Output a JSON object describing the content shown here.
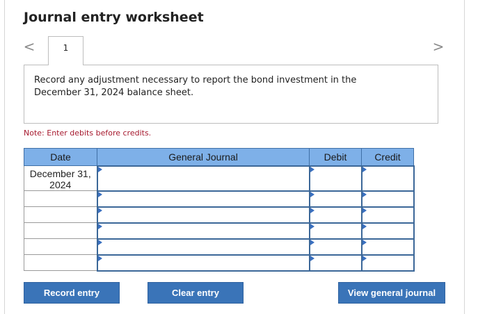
{
  "title": "Journal entry worksheet",
  "nav": {
    "prev": "<",
    "next": ">"
  },
  "tabs": [
    {
      "label": "1"
    }
  ],
  "prompt": "Record any adjustment necessary to report the bond investment in the December 31, 2024 balance sheet.",
  "note": "Note: Enter debits before credits.",
  "table": {
    "headers": {
      "date": "Date",
      "journal": "General Journal",
      "debit": "Debit",
      "credit": "Credit"
    },
    "rows": [
      {
        "date": "December 31, 2024",
        "account": "",
        "debit": "",
        "credit": ""
      },
      {
        "date": "",
        "account": "",
        "debit": "",
        "credit": ""
      },
      {
        "date": "",
        "account": "",
        "debit": "",
        "credit": ""
      },
      {
        "date": "",
        "account": "",
        "debit": "",
        "credit": ""
      },
      {
        "date": "",
        "account": "",
        "debit": "",
        "credit": ""
      },
      {
        "date": "",
        "account": "",
        "debit": "",
        "credit": ""
      }
    ]
  },
  "buttons": {
    "record": "Record entry",
    "clear": "Clear entry",
    "view": "View general journal"
  },
  "colors": {
    "header_bg": "#7eb0e8",
    "button_bg": "#3a74b8",
    "note": "#a6192e",
    "input_border": "#3b6798"
  }
}
